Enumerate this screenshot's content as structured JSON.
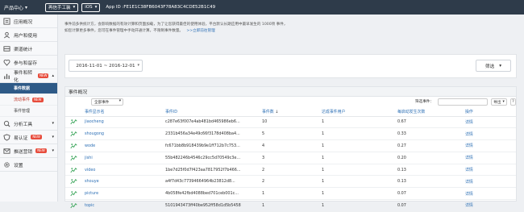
{
  "topbar": {
    "product_center": "产品中心",
    "app_name": "再信手工装",
    "platform": "iOS",
    "app_id": "App ID :FE1E1C38FB6043F78A83C4CDE52B1C49"
  },
  "sidebar": {
    "items": [
      {
        "label": "应用概况",
        "icon": "app-overview-icon"
      },
      {
        "label": "用户和使用",
        "icon": "users-icon"
      },
      {
        "label": "渠道统计",
        "icon": "channel-icon"
      },
      {
        "label": "参与和留存",
        "icon": "retention-icon"
      },
      {
        "label": "事件和转化",
        "icon": "event-icon",
        "badge": "NEW"
      }
    ],
    "subitems": [
      {
        "label": "事件数据",
        "active": true
      },
      {
        "label": "流动事件",
        "badge": "NEW",
        "red": true
      },
      {
        "label": "事件管理"
      }
    ],
    "items2": [
      {
        "label": "分析工具",
        "icon": "analysis-icon"
      },
      {
        "label": "易认证",
        "icon": "verify-icon",
        "badge": "NEW"
      },
      {
        "label": "推送营销",
        "icon": "push-icon",
        "badge": "NEW"
      },
      {
        "label": "设置",
        "icon": "settings-icon"
      }
    ]
  },
  "notice": {
    "line1": "事件前多供统计方，会影响数据的有效计算和页面加载，为了让您获得最佳的使用体验，平台默认长期应用中最早发生的 1000项 事件，",
    "line2": "如您计算更多事件，您可在事件管理中手动开通计算，不限制事件数量。",
    "link": ">>立即前往管理"
  },
  "datebar": {
    "range": "2016-11-01 ~ 2016-12-01",
    "filter_label": "筛选"
  },
  "panel": {
    "title": "事件概况",
    "category": "全部事件",
    "filter_label": "筛选事件：",
    "export_label": "导出",
    "help": "?",
    "headers": [
      "事件显示名",
      "事件ID",
      "事件数",
      "达成事件用户",
      "每启动发生次数",
      "操作"
    ],
    "rows": [
      {
        "name": "jiaocheng",
        "id": "c287e63f007e4ab481bd465986eb6...",
        "count": "10",
        "users": "1",
        "avg": "0.67",
        "op": "详情"
      },
      {
        "name": "shougong",
        "id": "2331b456a34e49c66f3178d408ba4...",
        "count": "5",
        "users": "1",
        "avg": "0.33",
        "op": "详情"
      },
      {
        "name": "wode",
        "id": "fc671bb8b918439b9e1ff712b7c753...",
        "count": "4",
        "users": "1",
        "avg": "0.27",
        "op": "详情"
      },
      {
        "name": "jishi",
        "id": "55b482246b4546c29cc5d70549c3e...",
        "count": "3",
        "users": "1",
        "avg": "0.20",
        "op": "详情"
      },
      {
        "name": "video",
        "id": "1be7d25f0d7f423aa7817952f7b466...",
        "count": "2",
        "users": "1",
        "avg": "0.13",
        "op": "详情"
      },
      {
        "name": "shouye",
        "id": "a4f7d43c77394664964b23812d8...",
        "count": "2",
        "users": "1",
        "avg": "0.13",
        "op": "详情"
      },
      {
        "name": "picture",
        "id": "4b058fe42fbd4088bed701ceb001c...",
        "count": "1",
        "users": "1",
        "avg": "0.07",
        "op": "详情"
      },
      {
        "name": "topic",
        "id": "5101943473ff40be952ff58d1d5b5458",
        "count": "1",
        "users": "1",
        "avg": "0.07",
        "op": "详情"
      }
    ]
  }
}
